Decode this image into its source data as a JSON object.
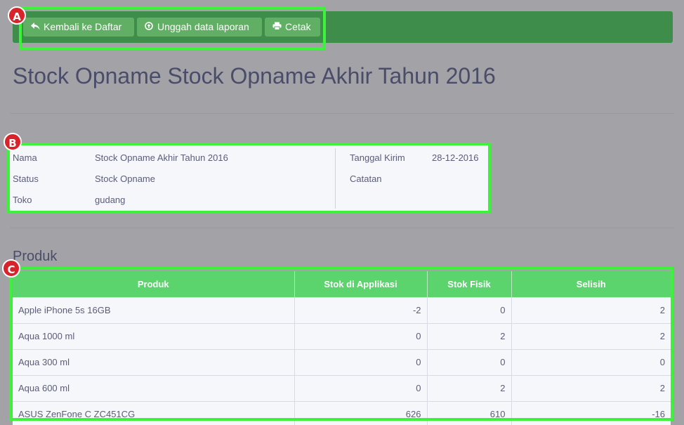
{
  "toolbar": {
    "back_label": "Kembali ke Daftar",
    "upload_label": "Unggah data laporan",
    "print_label": "Cetak"
  },
  "page": {
    "title": "Stock Opname Stock Opname Akhir Tahun 2016"
  },
  "info": {
    "nama_label": "Nama",
    "nama_value": "Stock Opname Akhir Tahun 2016",
    "status_label": "Status",
    "status_value": "Stock Opname",
    "toko_label": "Toko",
    "toko_value": "gudang",
    "tanggal_label": "Tanggal Kirim",
    "tanggal_value": "28-12-2016",
    "catatan_label": "Catatan"
  },
  "produk": {
    "section_title": "Produk",
    "columns": [
      "Produk",
      "Stok di Applikasi",
      "Stok Fisik",
      "Selisih"
    ],
    "rows": [
      [
        "Apple iPhone 5s 16GB",
        "-2",
        "0",
        "2"
      ],
      [
        "Aqua 1000 ml",
        "0",
        "2",
        "2"
      ],
      [
        "Aqua 300 ml",
        "0",
        "0",
        "0"
      ],
      [
        "Aqua 600 ml",
        "0",
        "2",
        "2"
      ],
      [
        "ASUS ZenFone C ZC451CG",
        "626",
        "610",
        "-16"
      ]
    ]
  },
  "markers": {
    "a": "A",
    "b": "B",
    "c": "C"
  },
  "icons": {
    "back": "reply-icon",
    "upload": "upload-circle-icon",
    "print": "printer-icon"
  },
  "colors": {
    "toolbar": "#3e8d4a",
    "button": "#61ae65",
    "table_header": "#5bd46e",
    "highlight": "#3df23a",
    "marker": "#d8232a"
  }
}
